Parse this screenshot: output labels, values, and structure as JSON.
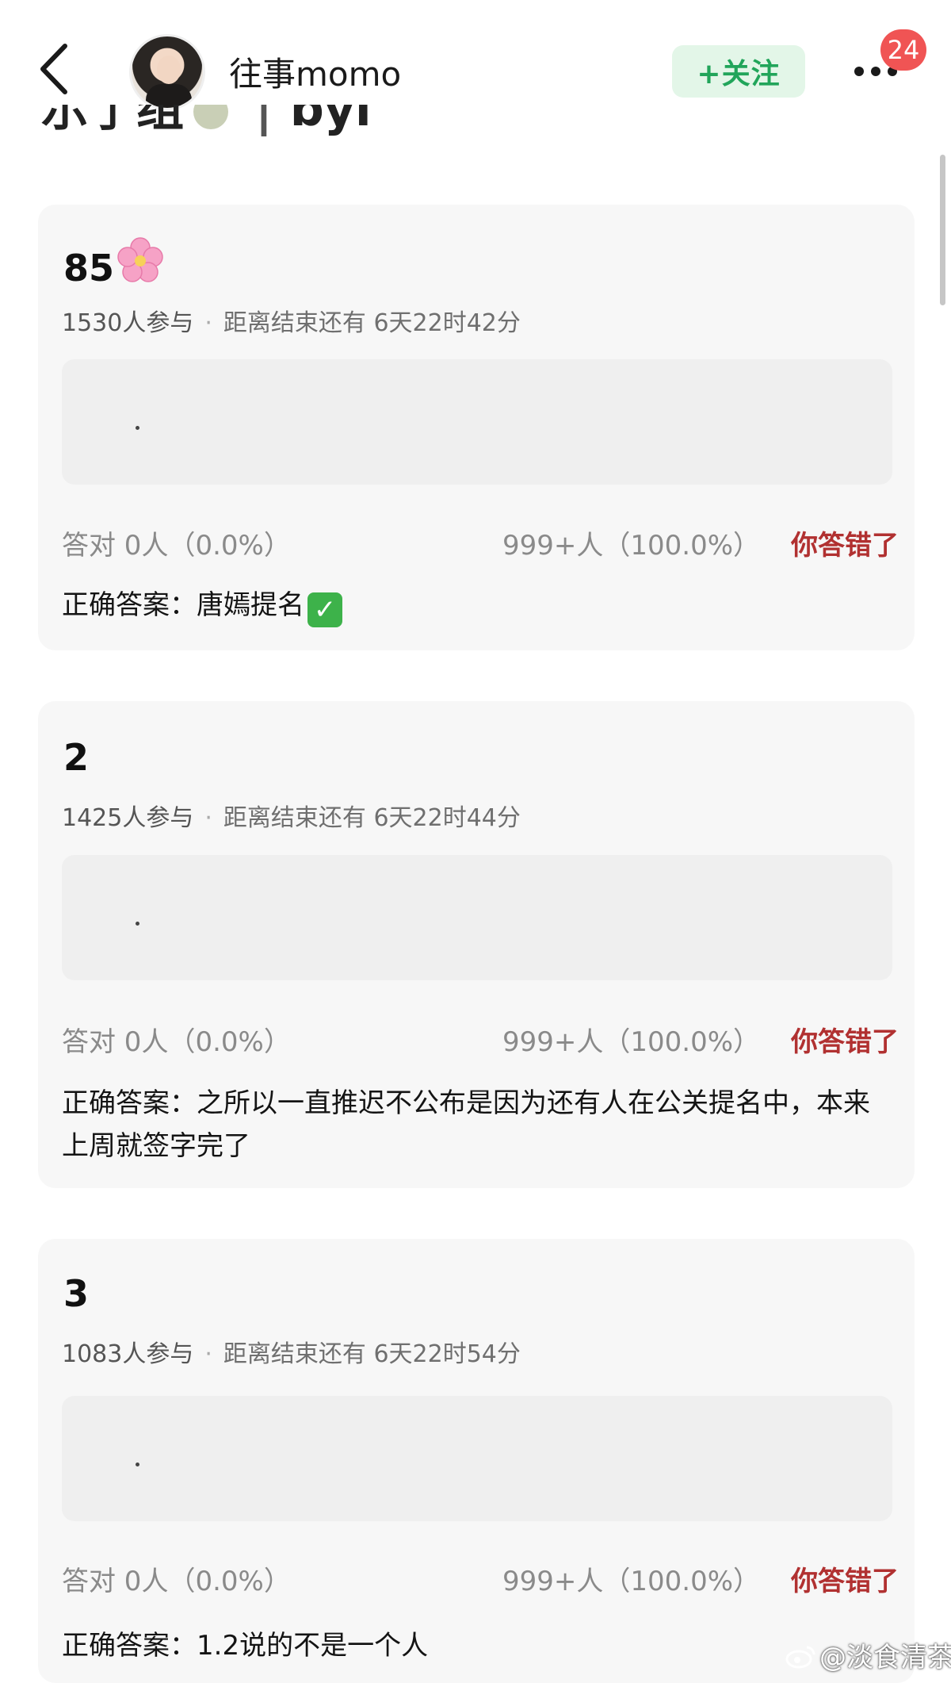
{
  "header": {
    "username": "往事momo",
    "follow_label": "+关注",
    "badge_count": "24",
    "subtitle_partial": "示了组",
    "subtitle_tail": "byl"
  },
  "icons": {
    "back": "back-chevron-icon",
    "more": "more-dots-icon",
    "flower": "cherry-blossom-icon",
    "check": "check-mark-icon",
    "weibo": "weibo-logo-icon"
  },
  "colors": {
    "follow_text": "#21a55a",
    "follow_bg": "#e3f6e8",
    "wrong_text": "#b13131",
    "badge": "#f05454"
  },
  "quizzes": [
    {
      "title": "85",
      "participants": "1530人参与",
      "remaining_label": "距离结束还有",
      "remaining": "6天22时42分",
      "option_text": ".",
      "correct_stats": "答对  0人（0.0%）",
      "wrong_stats": "999+人（100.0%）",
      "result": "你答错了",
      "answer_label": "正确答案：",
      "answer_text": "唐嫣提名"
    },
    {
      "title": "2",
      "participants": "1425人参与",
      "remaining_label": "距离结束还有",
      "remaining": "6天22时44分",
      "option_text": ".",
      "correct_stats": "答对  0人（0.0%）",
      "wrong_stats": "999+人（100.0%）",
      "result": "你答错了",
      "answer_label": "正确答案：",
      "answer_text": "之所以一直推迟不公布是因为还有人在公关提名中，本来上周就签字完了"
    },
    {
      "title": "3",
      "participants": "1083人参与",
      "remaining_label": "距离结束还有",
      "remaining": "6天22时54分",
      "option_text": ".",
      "correct_stats": "答对  0人（0.0%）",
      "wrong_stats": "999+人（100.0%）",
      "result": "你答错了",
      "answer_label": "正确答案：",
      "answer_text": "1.2说的不是一个人"
    }
  ],
  "watermark": "@淡食清茶"
}
